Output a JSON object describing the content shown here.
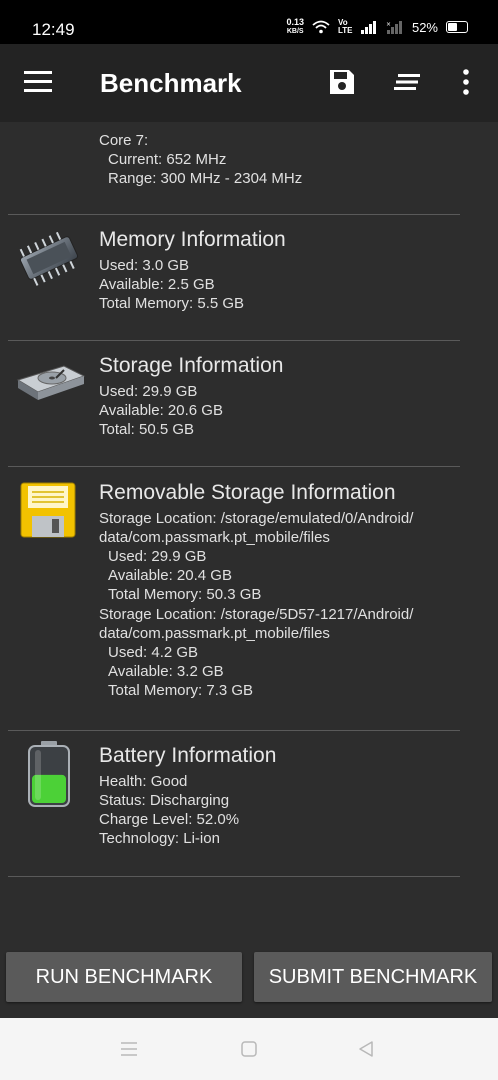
{
  "status_bar": {
    "time": "12:49",
    "net_speed_value": "0.13",
    "net_speed_unit": "KB/S",
    "network_label": "Vo LTE",
    "battery_percent": "52%"
  },
  "app_bar": {
    "title": "Benchmark",
    "icons": [
      "menu-icon",
      "save-icon",
      "sort-icon",
      "more-vert-icon"
    ]
  },
  "core": {
    "name": "Core 7:",
    "current": "Current: 652 MHz",
    "range": "Range: 300 MHz - 2304 MHz"
  },
  "memory": {
    "title": "Memory Information",
    "icon": "memory-chip-icon",
    "lines": [
      "Used: 3.0 GB",
      "Available: 2.5 GB",
      "Total Memory: 5.5 GB"
    ]
  },
  "storage": {
    "title": "Storage Information",
    "icon": "hard-drive-icon",
    "lines": [
      "Used: 29.9 GB",
      "Available: 20.6 GB",
      "Total: 50.5 GB"
    ]
  },
  "removable": {
    "title": "Removable Storage Information",
    "icon": "floppy-disk-icon",
    "loc1_a": "Storage Location: /storage/emulated/0/Android/",
    "loc1_b": "data/com.passmark.pt_mobile/files",
    "loc1_used": "Used: 29.9 GB",
    "loc1_available": "Available: 20.4 GB",
    "loc1_total": "Total Memory: 50.3 GB",
    "loc2_a": "Storage Location: /storage/5D57-1217/Android/",
    "loc2_b": "data/com.passmark.pt_mobile/files",
    "loc2_used": "Used: 4.2 GB",
    "loc2_available": "Available: 3.2 GB",
    "loc2_total": "Total Memory: 7.3 GB"
  },
  "battery": {
    "title": "Battery Information",
    "icon": "battery-icon",
    "charge_level": 0.52,
    "lines": [
      "Health: Good",
      "Status: Discharging",
      "Charge Level: 52.0%",
      "Technology: Li-ion"
    ]
  },
  "buttons": {
    "run": "RUN BENCHMARK",
    "submit": "SUBMIT BENCHMARK"
  },
  "nav_bar": {
    "icons": [
      "nav-menu-icon",
      "nav-home-icon",
      "nav-back-icon"
    ]
  },
  "colors": {
    "background": "#2d2d2d",
    "app_bar": "#232323",
    "button": "#5a5a5a",
    "battery_green": "#4cd137",
    "floppy_yellow": "#f2c200"
  }
}
